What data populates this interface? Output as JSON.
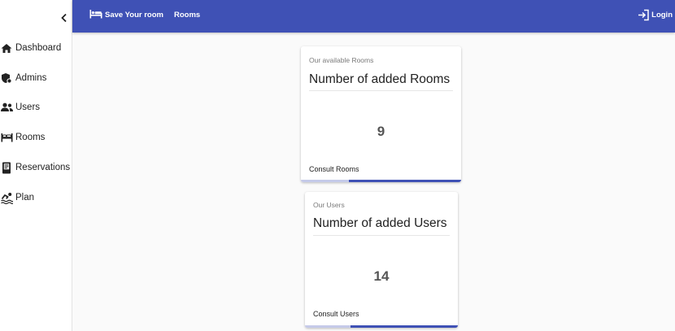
{
  "sidebar": {
    "items": [
      {
        "label": "Dashboard",
        "icon": "home-icon"
      },
      {
        "label": "Admins",
        "icon": "admin-shield-icon"
      },
      {
        "label": "Users",
        "icon": "users-icon"
      },
      {
        "label": "Rooms",
        "icon": "bed-icon"
      },
      {
        "label": "Reservations",
        "icon": "book-icon"
      },
      {
        "label": "Plan",
        "icon": "swimmer-icon"
      }
    ]
  },
  "topbar": {
    "brand": "Save Your room",
    "link": "Rooms",
    "login": "Login",
    "color": "#3f51b5"
  },
  "cards": [
    {
      "subtitle": "Our available Rooms",
      "title": "Number of added Rooms",
      "count": "9",
      "consult": "Consult Rooms",
      "progress": 0.7
    },
    {
      "subtitle": "Our Users",
      "title": "Number of added Users",
      "count": "14",
      "consult": "Consult Users",
      "progress": 0.7
    }
  ]
}
